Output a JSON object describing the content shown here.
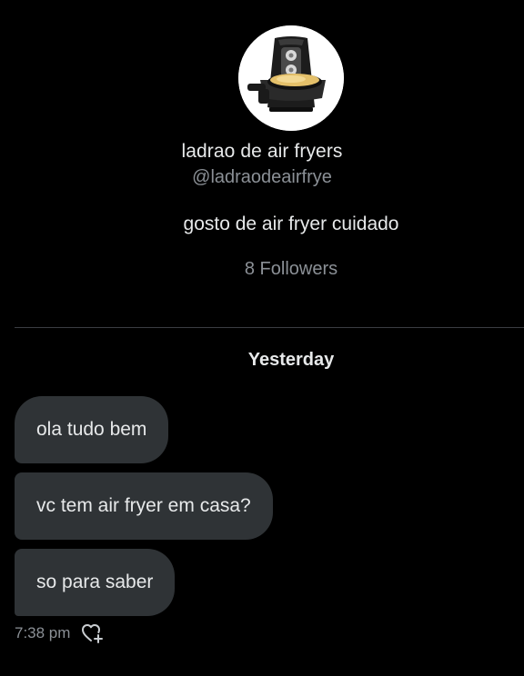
{
  "profile": {
    "name": "ladrao de air fryers",
    "handle": "@ladraodeairfrye",
    "bio": "gosto de air fryer cuidado",
    "followers": "8 Followers",
    "avatar_icon": "air-fryer-icon"
  },
  "conversation": {
    "date_label": "Yesterday",
    "messages": [
      {
        "text": "ola tudo bem"
      },
      {
        "text": "vc tem air fryer em casa?"
      },
      {
        "text": "so para saber"
      }
    ],
    "timestamp": "7:38 pm",
    "reaction_icon": "add-reaction-heart-icon"
  },
  "colors": {
    "background": "#000000",
    "bubble": "#2f3336",
    "text_primary": "#e7e9ea",
    "text_secondary": "#8b9096",
    "divider": "#3a3d42"
  }
}
